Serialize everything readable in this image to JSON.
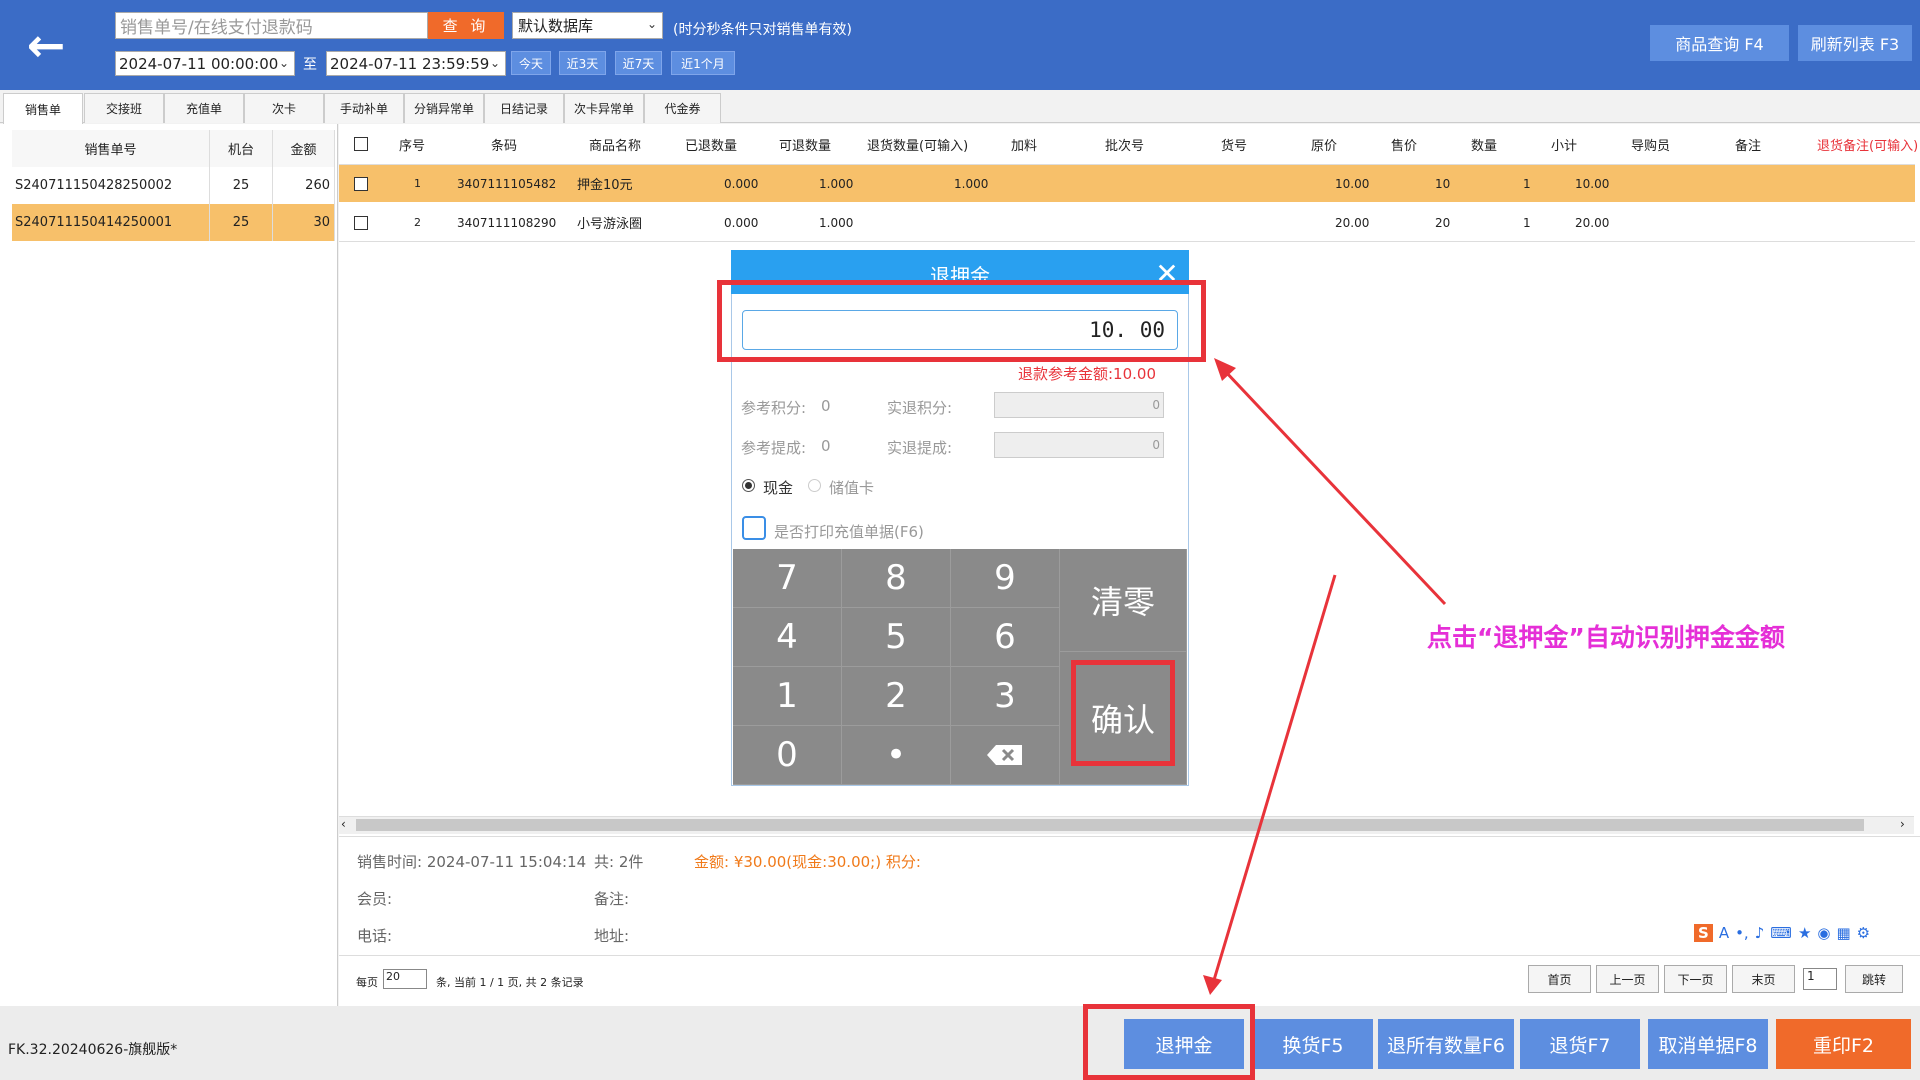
{
  "header": {
    "search_placeholder": "销售单号/在线支付退款码",
    "query_label": "查 询",
    "db_selected": "默认数据库",
    "hint": "(时分秒条件只对销售单有效)",
    "date_from": "2024-07-11 00:00:00",
    "date_to_label": "至",
    "date_to": "2024-07-11 23:59:59",
    "quick_ranges": [
      "今天",
      "近3天",
      "近7天",
      "近1个月"
    ],
    "product_query": "商品查询 F4",
    "refresh_list": "刷新列表 F3"
  },
  "tabs": [
    "销售单",
    "交接班",
    "充值单",
    "次卡",
    "手动补单",
    "分销异常单",
    "日结记录",
    "次卡异常单",
    "代金券"
  ],
  "left_table": {
    "headers": [
      "销售单号",
      "机台",
      "金额"
    ],
    "rows": [
      {
        "no": "S240711150428250002",
        "machine": "25",
        "amount": "260"
      },
      {
        "no": "S240711150414250001",
        "machine": "25",
        "amount": "30"
      }
    ]
  },
  "main_table": {
    "headers": [
      "序号",
      "条码",
      "商品名称",
      "已退数量",
      "可退数量",
      "退货数量(可输入)",
      "加料",
      "批次号",
      "货号",
      "原价",
      "售价",
      "数量",
      "小计",
      "导购员",
      "备注",
      "退货备注(可输入)"
    ],
    "rows": [
      {
        "seq": "1",
        "barcode": "3407111105482",
        "name": "押金10元",
        "returned": "0.000",
        "returnable": "1.000",
        "return_qty": "1.000",
        "orig": "10.00",
        "price": "10",
        "qty": "1",
        "subtotal": "10.00"
      },
      {
        "seq": "2",
        "barcode": "3407111108290",
        "name": "小号游泳圈",
        "returned": "0.000",
        "returnable": "1.000",
        "return_qty": "",
        "orig": "20.00",
        "price": "20",
        "qty": "1",
        "subtotal": "20.00"
      }
    ]
  },
  "info": {
    "sale_time": "销售时间: 2024-07-11 15:04:14",
    "count": "共: 2件",
    "amount": "金额: ¥30.00(现金:30.00;) 积分:",
    "member": "会员:",
    "remark": "备注:",
    "phone": "电话:",
    "address": "地址:"
  },
  "pager": {
    "per_page_label": "每页",
    "per_page": "20",
    "summary": "条, 当前 1 / 1 页, 共 2 条记录",
    "first": "首页",
    "prev": "上一页",
    "next": "下一页",
    "last": "末页",
    "page": "1",
    "jump": "跳转"
  },
  "footer": {
    "version": "FK.32.20240626-旗舰版*",
    "buttons": {
      "deposit": "退押金",
      "exchange": "换货F5",
      "return_all": "退所有数量F6",
      "return": "退货F7",
      "cancel": "取消单据F8",
      "reprint": "重印F2"
    }
  },
  "modal": {
    "title": "退押金",
    "close": "✕",
    "amount": "10. 00",
    "reference": "退款参考金额:10.00",
    "ref_points_label": "参考积分:",
    "ref_points": "0",
    "real_points_label": "实退积分:",
    "real_points": "0",
    "ref_commission_label": "参考提成:",
    "ref_commission": "0",
    "real_commission_label": "实退提成:",
    "real_commission": "0",
    "pay_cash": "现金",
    "pay_card": "储值卡",
    "print_label": "是否打印充值单据(F6)",
    "keys": [
      "7",
      "8",
      "9",
      "4",
      "5",
      "6",
      "1",
      "2",
      "3",
      "0",
      "•"
    ],
    "clear": "清零",
    "confirm": "确认"
  },
  "annotation": "点击“退押金”自动识别押金金额",
  "colors": {
    "header": "#3b6cc6",
    "accent_orange": "#f06a2a",
    "selected_row": "#f7c06a",
    "button_blue": "#5d8ee0",
    "highlight_red": "#e8333a",
    "annotation": "#e52fd7"
  }
}
